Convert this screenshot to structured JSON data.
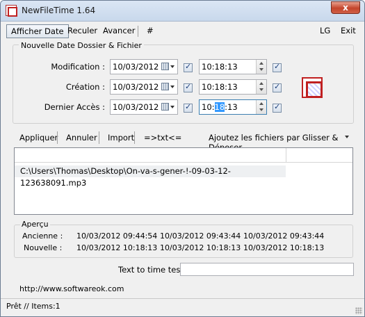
{
  "window": {
    "title": "NewFileTime 1.64",
    "close_glyph": "x"
  },
  "menu": {
    "afficher_date": "Afficher Date",
    "reculer": "Reculer",
    "avancer": "Avancer",
    "hash": "#",
    "lg": "LG",
    "exit": "Exit"
  },
  "dates": {
    "group_title": "Nouvelle Date Dossier & Fichier",
    "rows": [
      {
        "label": "Modification :",
        "date": "10/03/2012",
        "date_checked": true,
        "time": "10:18:13",
        "time_checked": true
      },
      {
        "label": "Création :",
        "date": "10/03/2012",
        "date_checked": true,
        "time": "10:18:13",
        "time_checked": true
      },
      {
        "label": "Dernier Accès :",
        "date": "10/03/2012",
        "date_checked": true,
        "time_pre": "10:",
        "time_sel": "18",
        "time_post": ":13",
        "time_checked": true
      }
    ]
  },
  "toolbar": {
    "appliquer": "Appliquer",
    "annuler": "Annuler",
    "import": "Import",
    "txt": "=>txt<=",
    "dragdrop": "Ajoutez les fichiers par Glisser & Déposer"
  },
  "filelist": {
    "files": [
      "C:\\Users\\Thomas\\Desktop\\On-va-s-gener-!-09-03-12-123638091.mp3"
    ]
  },
  "apercu": {
    "title": "Aperçu",
    "ancienne_label": "Ancienne :",
    "nouvelle_label": "Nouvelle :",
    "ancienne": [
      "10/03/2012 09:44:54",
      "10/03/2012 09:43:44",
      "10/03/2012 09:43:44"
    ],
    "nouvelle": [
      "10/03/2012 10:18:13",
      "10/03/2012 10:18:13",
      "10/03/2012 10:18:13"
    ]
  },
  "tester": {
    "label": "Text to time tester",
    "value": ""
  },
  "footer": {
    "url": "http://www.softwareok.com"
  },
  "status": {
    "text": "Prêt // Items:1"
  },
  "icons": [
    "app-icon",
    "calendar-icon",
    "dropdown-arrow-icon",
    "spin-up-icon",
    "spin-down-icon",
    "checkbox-icon",
    "newfiletime-logo-icon",
    "resize-grip-icon"
  ]
}
